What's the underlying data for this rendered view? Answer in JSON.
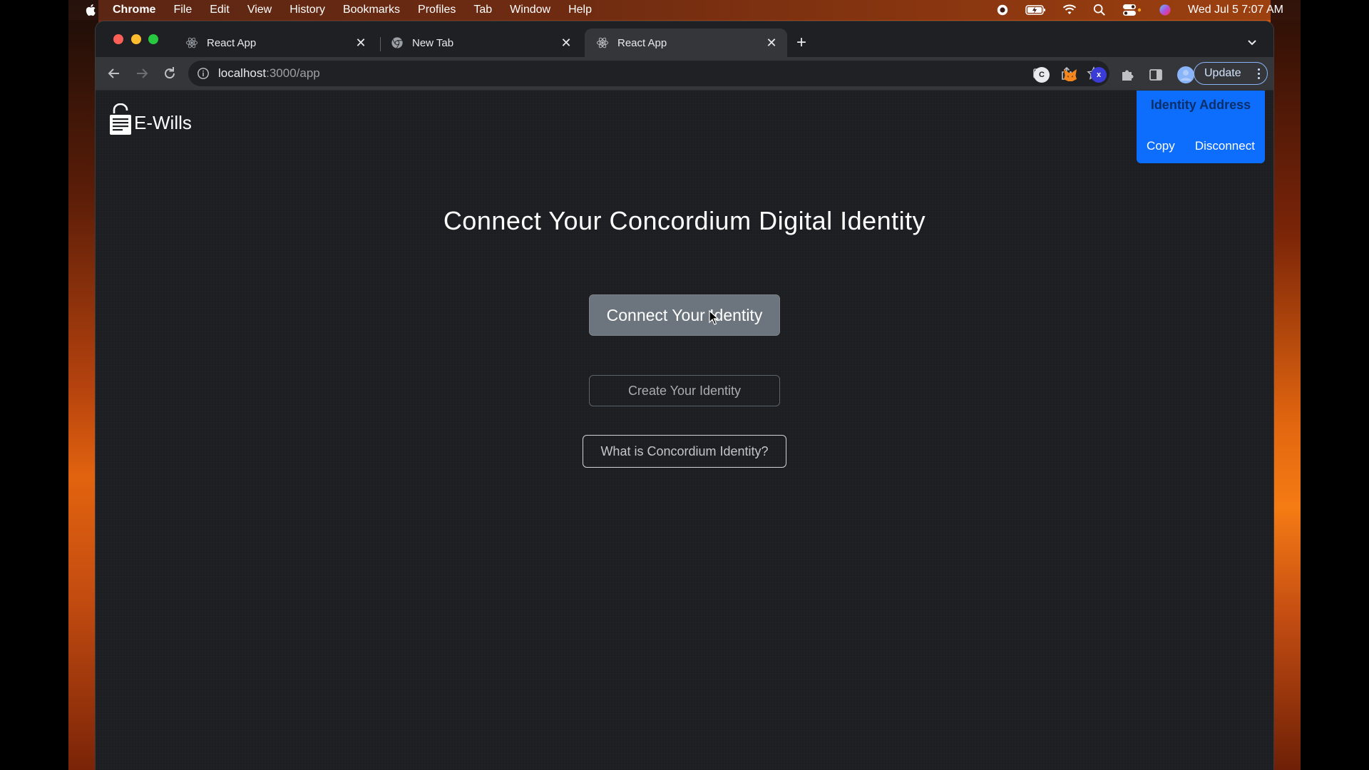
{
  "menubar": {
    "app_name": "Chrome",
    "items": [
      "File",
      "Edit",
      "View",
      "History",
      "Bookmarks",
      "Profiles",
      "Tab",
      "Window",
      "Help"
    ],
    "clock": "Wed Jul 5  7:07 AM"
  },
  "tabs": [
    {
      "title": "React App",
      "favicon": "react-icon",
      "active": false
    },
    {
      "title": "New Tab",
      "favicon": "chrome-icon",
      "active": false
    },
    {
      "title": "React App",
      "favicon": "react-icon",
      "active": true
    }
  ],
  "address_bar": {
    "host": "localhost",
    "path": ":3000/app"
  },
  "toolbar": {
    "update_label": "Update"
  },
  "page": {
    "brand_name": "E-Wills",
    "heading": "Connect Your Concordium Digital Identity",
    "connect_button": "Connect Your Identity",
    "create_button": "Create Your Identity",
    "what_button": "What is Concordium Identity?"
  },
  "identity_panel": {
    "title": "Identity Address",
    "copy_label": "Copy",
    "disconnect_label": "Disconnect"
  },
  "colors": {
    "panel_blue": "#0d6efd",
    "connect_gray": "#6c757d",
    "page_bg": "#1c1e21"
  }
}
